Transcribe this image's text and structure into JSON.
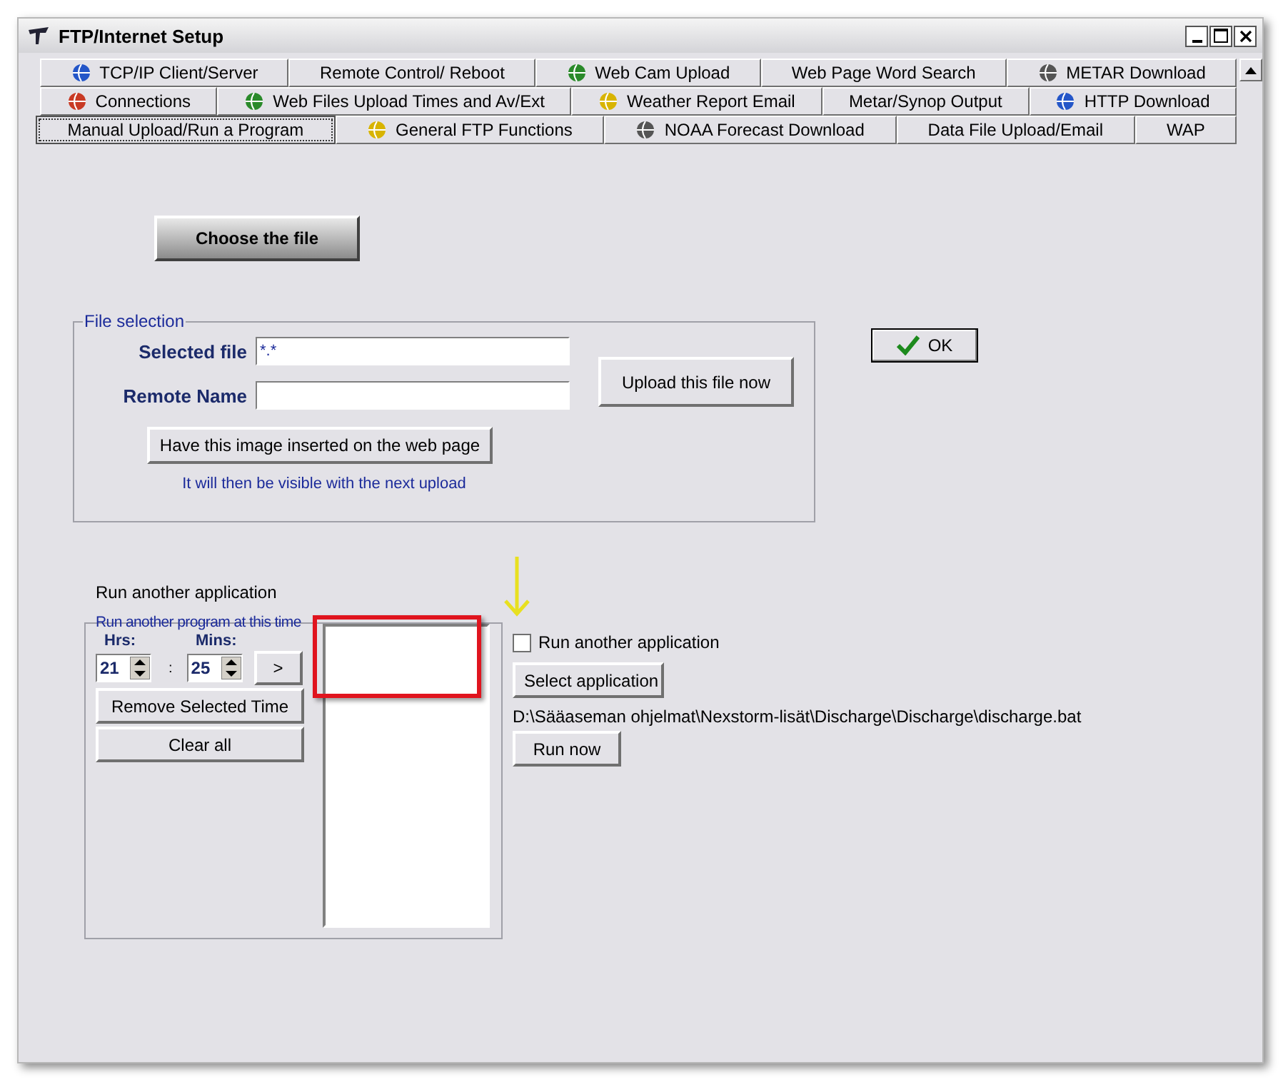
{
  "window": {
    "title": "FTP/Internet Setup"
  },
  "tab_rows": [
    {
      "tabs": [
        {
          "label": "TCP/IP Client/Server",
          "selected": false,
          "has_icon": true
        },
        {
          "label": "Remote Control/ Reboot",
          "selected": false,
          "has_icon": false
        },
        {
          "label": "Web Cam Upload",
          "selected": false,
          "has_icon": true
        },
        {
          "label": "Web Page Word Search",
          "selected": false,
          "has_icon": false
        },
        {
          "label": "METAR Download",
          "selected": false,
          "has_icon": true
        }
      ]
    },
    {
      "tabs": [
        {
          "label": "Connections",
          "selected": false,
          "has_icon": true
        },
        {
          "label": "Web Files Upload Times and  Av/Ext",
          "selected": false,
          "has_icon": true
        },
        {
          "label": "Weather Report Email",
          "selected": false,
          "has_icon": true
        },
        {
          "label": "Metar/Synop Output",
          "selected": false,
          "has_icon": false
        },
        {
          "label": "HTTP Download",
          "selected": false,
          "has_icon": true
        }
      ]
    },
    {
      "tabs": [
        {
          "label": "Manual Upload/Run a Program",
          "selected": true,
          "has_icon": false
        },
        {
          "label": "General FTP Functions",
          "selected": false,
          "has_icon": true
        },
        {
          "label": "NOAA Forecast Download",
          "selected": false,
          "has_icon": true
        },
        {
          "label": "Data File Upload/Email",
          "selected": false,
          "has_icon": false
        },
        {
          "label": "WAP",
          "selected": false,
          "has_icon": false
        }
      ]
    }
  ],
  "choose_button": "Choose the file",
  "file_selection": {
    "legend": "File selection",
    "selected_file_label": "Selected file",
    "selected_file_value": "*.*",
    "remote_name_label": "Remote Name",
    "upload_button": "Upload this file now",
    "insert_button": "Have this image inserted on the web page",
    "note": "It will then be visible with the next upload"
  },
  "ok_button": "OK",
  "run_app_heading": "Run another application",
  "schedule": {
    "legend": "Run another program at this time",
    "hrs_label": "Hrs:",
    "hrs_value": "21",
    "separator": ":",
    "mins_label": "Mins:",
    "mins_value": "25",
    "add_button": ">",
    "remove_button": "Remove Selected Time",
    "clear_button": "Clear all"
  },
  "run_app": {
    "checkbox_label": "Run another application",
    "checked": false,
    "select_button": "Select application",
    "path": "D:\\Sääaseman ohjelmat\\Nexstorm-lisät\\Discharge\\Discharge\\discharge.bat",
    "run_button": "Run now"
  }
}
